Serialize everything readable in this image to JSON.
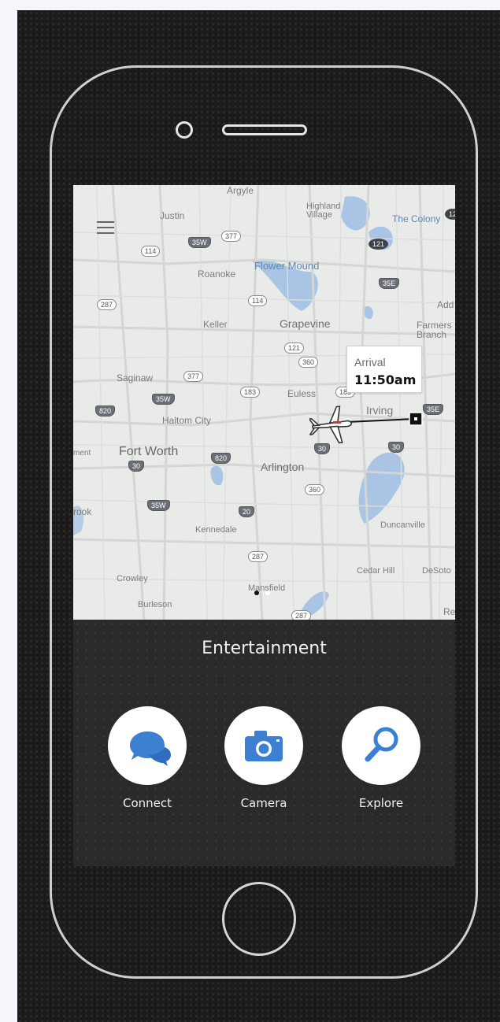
{
  "map": {
    "menu_icon": "hamburger-menu-icon",
    "labels": {
      "argyle": "Argyle",
      "justin": "Justin",
      "highland_village": "Highland Village",
      "the_colony": "The Colony",
      "flower_mound": "Flower Mound",
      "roanoke": "Roanoke",
      "keller": "Keller",
      "grapevine": "Grapevine",
      "farmers_branch": "Farmers Branch",
      "saginaw": "Saginaw",
      "euless": "Euless",
      "irving": "Irving",
      "haltom_city": "Haltom City",
      "fort_worth": "Fort Worth",
      "ment": "ment",
      "arlington": "Arlington",
      "brook": "rook",
      "kennedale": "Kennedale",
      "duncanville": "Duncanville",
      "crowley": "Crowley",
      "cedar_hill": "Cedar Hill",
      "desoto": "DeSoto",
      "burleson": "Burleson",
      "mansfield": "Mansfield",
      "add": "Add",
      "re": "Re"
    },
    "shields": {
      "s35w_top": "35W",
      "s377_top": "377",
      "s114_a": "114",
      "s114_b": "114",
      "s287_a": "287",
      "s121_a": "121",
      "s121_b": "121",
      "s360_a": "360",
      "s35e_a": "35E",
      "s377_b": "377",
      "s183_a": "183",
      "s183_b": "183",
      "s35w_b": "35W",
      "s820_a": "820",
      "s820_b": "820",
      "s30_a": "30",
      "s35e_b": "35E",
      "s30_b": "30",
      "s35w_c": "35W",
      "s30_c": "30",
      "s360_b": "360",
      "s20": "20",
      "s287_b": "287",
      "s287_c": "287",
      "s12": "12"
    },
    "arrival": {
      "label": "Arrival",
      "time": "11:50am"
    },
    "plane_icon": "airplane-icon",
    "pager_active_color": "#111111",
    "pager_inactive_color": "#ffffff"
  },
  "panel": {
    "title": "Entertainment",
    "actions": [
      {
        "label": "Connect",
        "icon": "chat-bubbles-icon",
        "color": "#3d7fd1"
      },
      {
        "label": "Camera",
        "icon": "camera-icon",
        "color": "#3d7fd1"
      },
      {
        "label": "Explore",
        "icon": "magnifier-icon",
        "color": "#3d7fd1"
      }
    ]
  }
}
